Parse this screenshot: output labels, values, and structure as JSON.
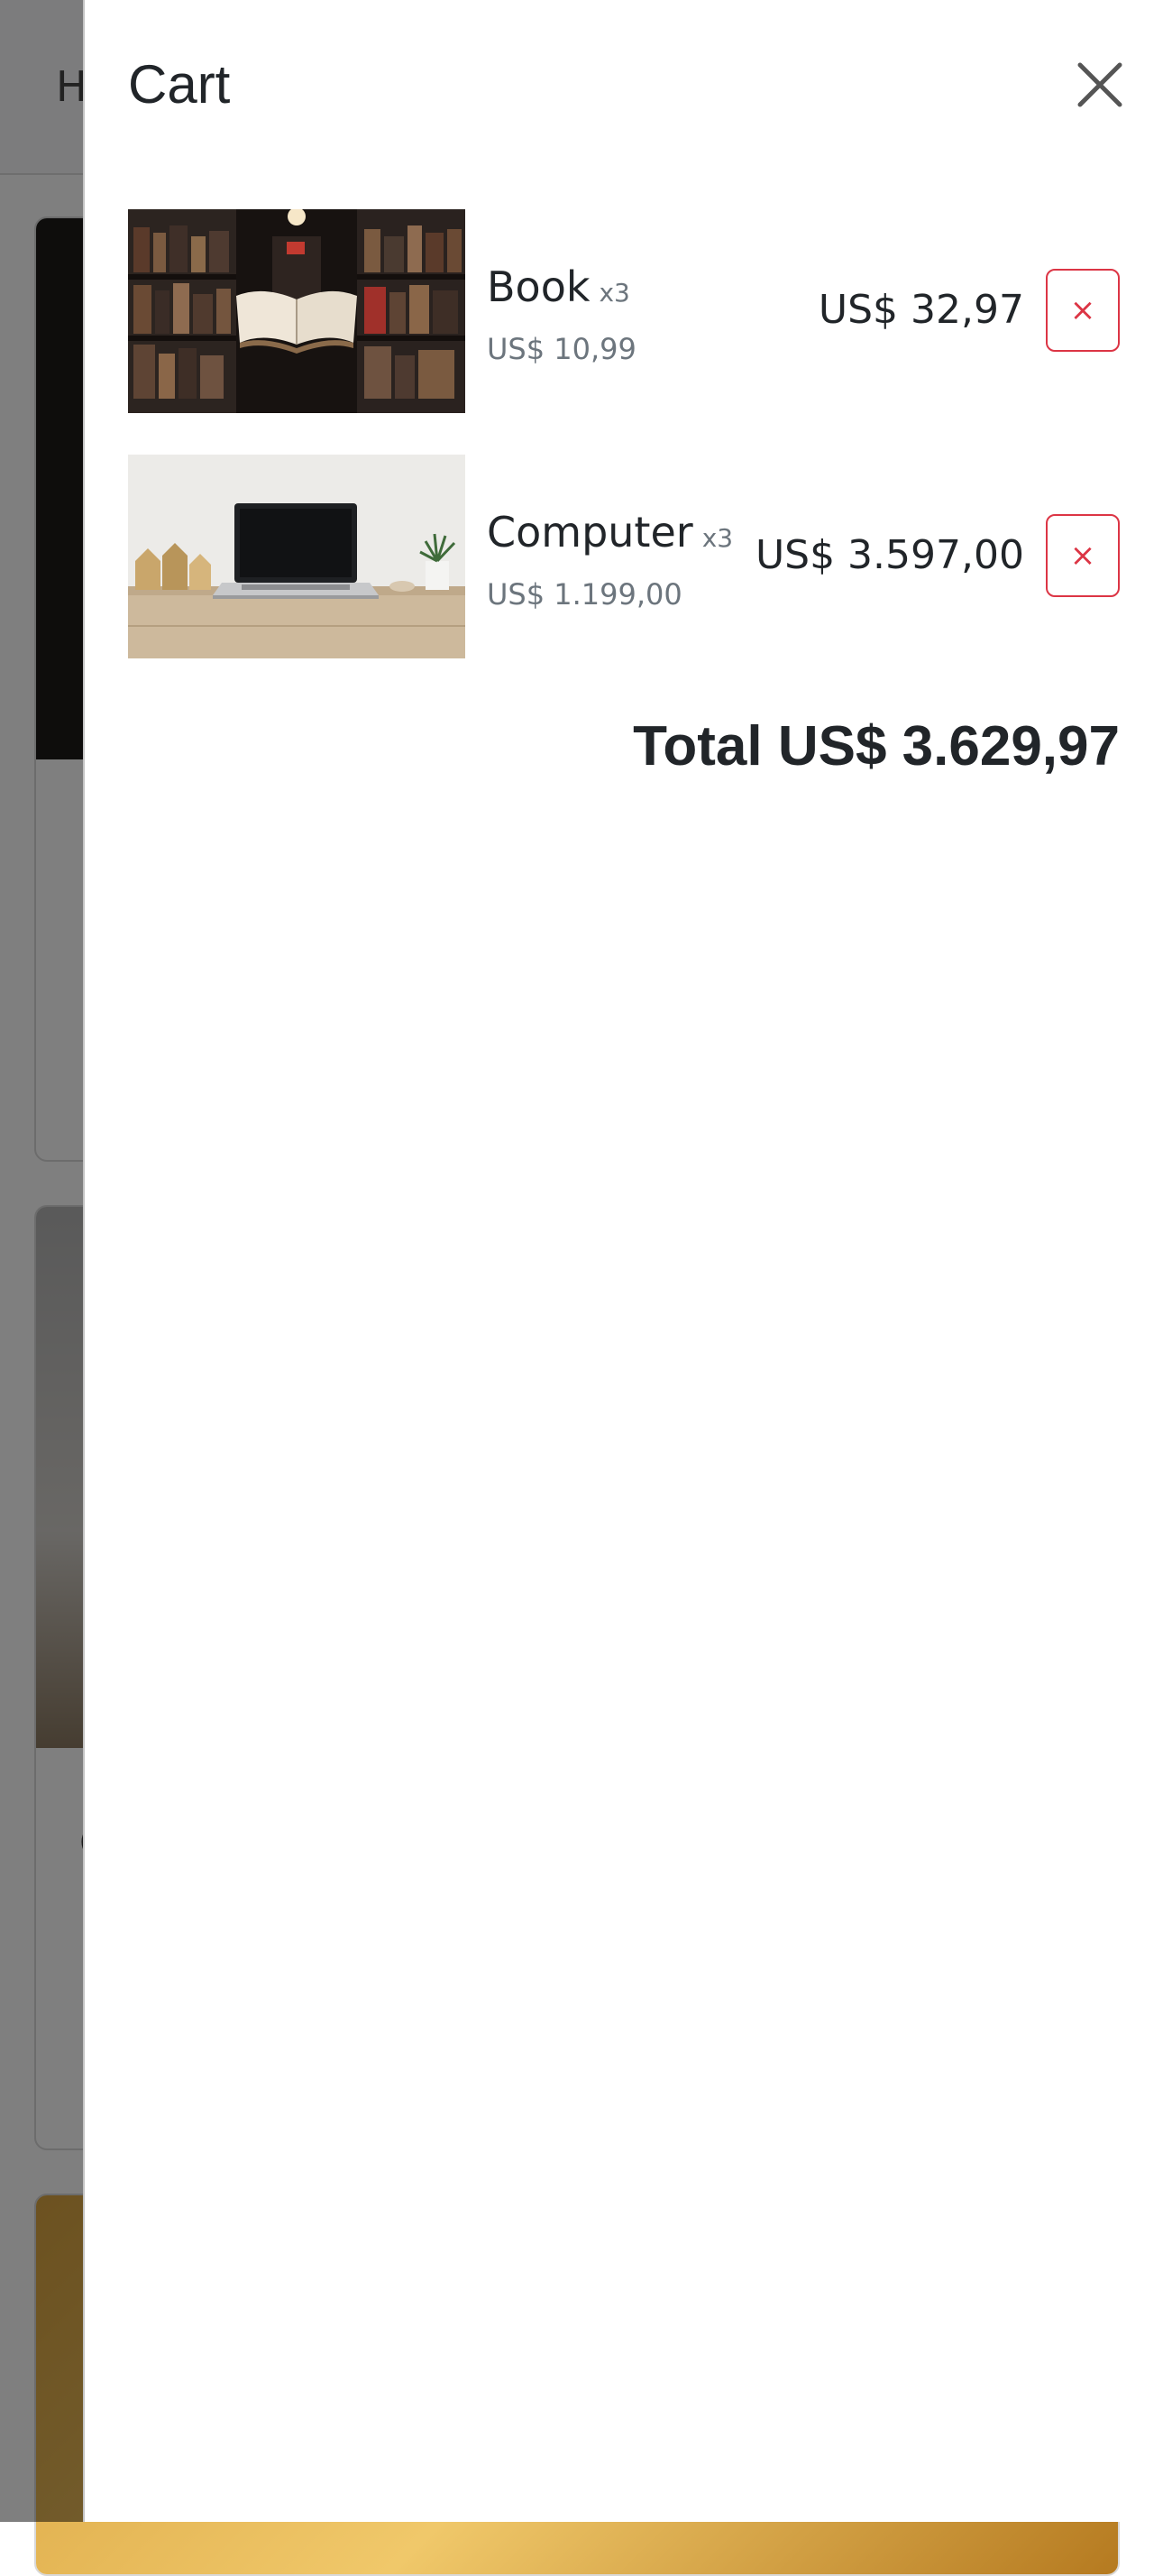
{
  "background_page": {
    "brand_letter": "H",
    "card_title_letter": "C"
  },
  "cart": {
    "title": "Cart",
    "close_icon": "close-icon",
    "remove_label": "×",
    "items": [
      {
        "name": "Book",
        "qty": "x3",
        "unit_price": "US$ 10,99",
        "line_total": "US$ 32,97",
        "image": "book-photo"
      },
      {
        "name": "Computer",
        "qty": "x3",
        "unit_price": "US$ 1.199,00",
        "line_total": "US$ 3.597,00",
        "image": "laptop-photo"
      }
    ],
    "total_label": "Total",
    "total_value": "US$ 3.629,97"
  },
  "colors": {
    "danger": "#dc3545",
    "muted": "#6c757d",
    "text": "#212529",
    "backdrop": "rgba(0,0,0,0.5)"
  }
}
